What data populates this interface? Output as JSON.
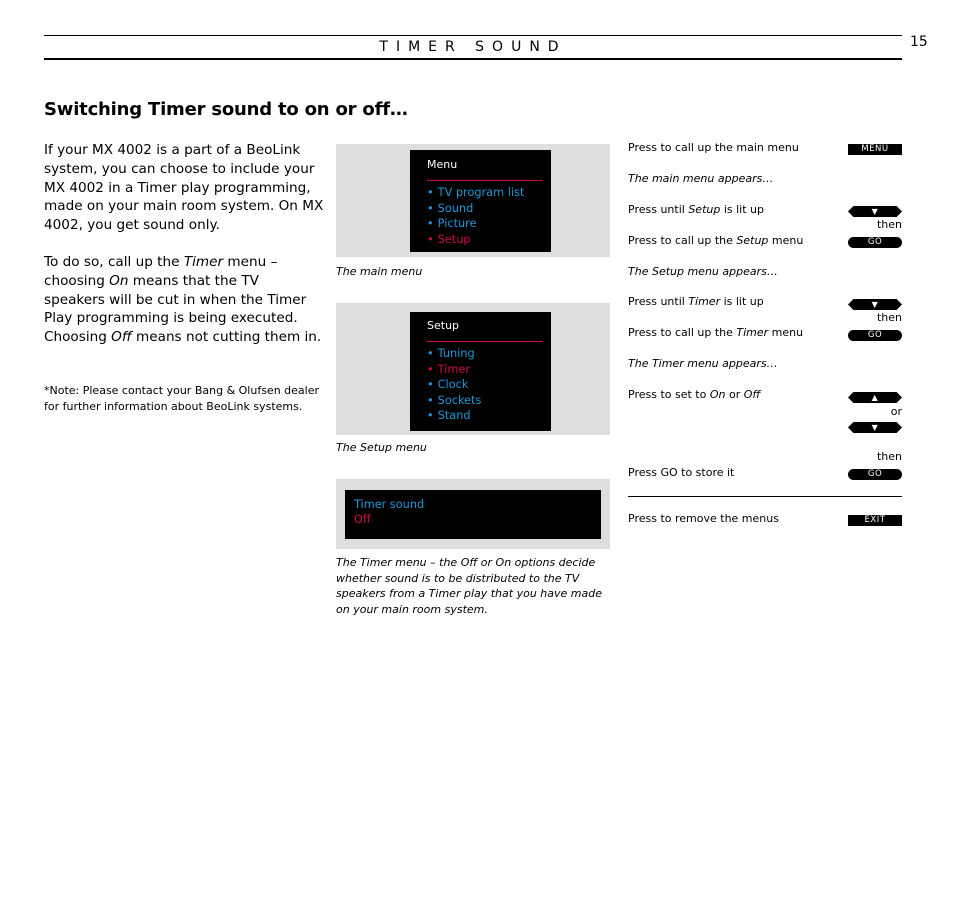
{
  "header": {
    "section_title": "TIMER SOUND",
    "page_number": "15"
  },
  "heading": "Switching Timer sound to on or off…",
  "body": {
    "p1": "If your MX 4002 is a part of a BeoLink system, you can choose to include your MX 4002 in a Timer play programming, made on your main room system. On MX 4002, you get sound only.",
    "p2": {
      "a": "To do so, call up the ",
      "timer": "Timer",
      "b": " menu – choosing ",
      "on": "On",
      "c": " means that the TV speakers will be cut in when the Timer Play programming is being executed. Choosing ",
      "off": "Off",
      "d": " means not cutting them in."
    },
    "note": "*Note: Please contact your Bang & Olufsen dealer for further information about BeoLink systems."
  },
  "screens": {
    "main_menu": {
      "title": "Menu",
      "items": [
        {
          "label": "TV program list",
          "active": false
        },
        {
          "label": "Sound",
          "active": false
        },
        {
          "label": "Picture",
          "active": false
        },
        {
          "label": "Setup",
          "active": true
        }
      ],
      "caption": "The main menu"
    },
    "setup_menu": {
      "title": "Setup",
      "items": [
        {
          "label": "Tuning",
          "active": false
        },
        {
          "label": "Timer",
          "active": true
        },
        {
          "label": "Clock",
          "active": false
        },
        {
          "label": "Sockets",
          "active": false
        },
        {
          "label": "Stand",
          "active": false
        }
      ],
      "caption": "The Setup menu"
    },
    "timer_menu": {
      "label": "Timer sound",
      "value": "Off",
      "caption": "The Timer menu – the Off or On options decide whether sound is to be distributed to the TV speakers from a Timer play that you have made on your main room system."
    },
    "bullet": "•"
  },
  "instructions": {
    "s1": "Press to call up the main menu",
    "s2": "The main menu appears…",
    "s3a": "Press until ",
    "s3b": "Setup",
    "s3c": " is lit up",
    "s4a": "Press to call up the ",
    "s4b": "Setup",
    "s4c": " menu",
    "s5": "The Setup menu appears…",
    "s6a": "Press until ",
    "s6b": "Timer",
    "s6c": " is lit up",
    "s7a": "Press to call up the ",
    "s7b": "Timer",
    "s7c": " menu",
    "s8": "The Timer menu appears…",
    "s9a": "Press to set to ",
    "s9b": "On",
    "s9c": " or ",
    "s9d": "Off",
    "s10": "Press GO to store it",
    "s11": "Press to remove the menus"
  },
  "buttons": {
    "menu": "MENU",
    "go": "GO",
    "down": "▼",
    "up": "▲",
    "exit": "EXIT",
    "then": "then",
    "or": "or"
  },
  "colors": {
    "menu_item": "#1a9ad6",
    "highlight": "#d10a3c",
    "panel": "#dedede"
  }
}
